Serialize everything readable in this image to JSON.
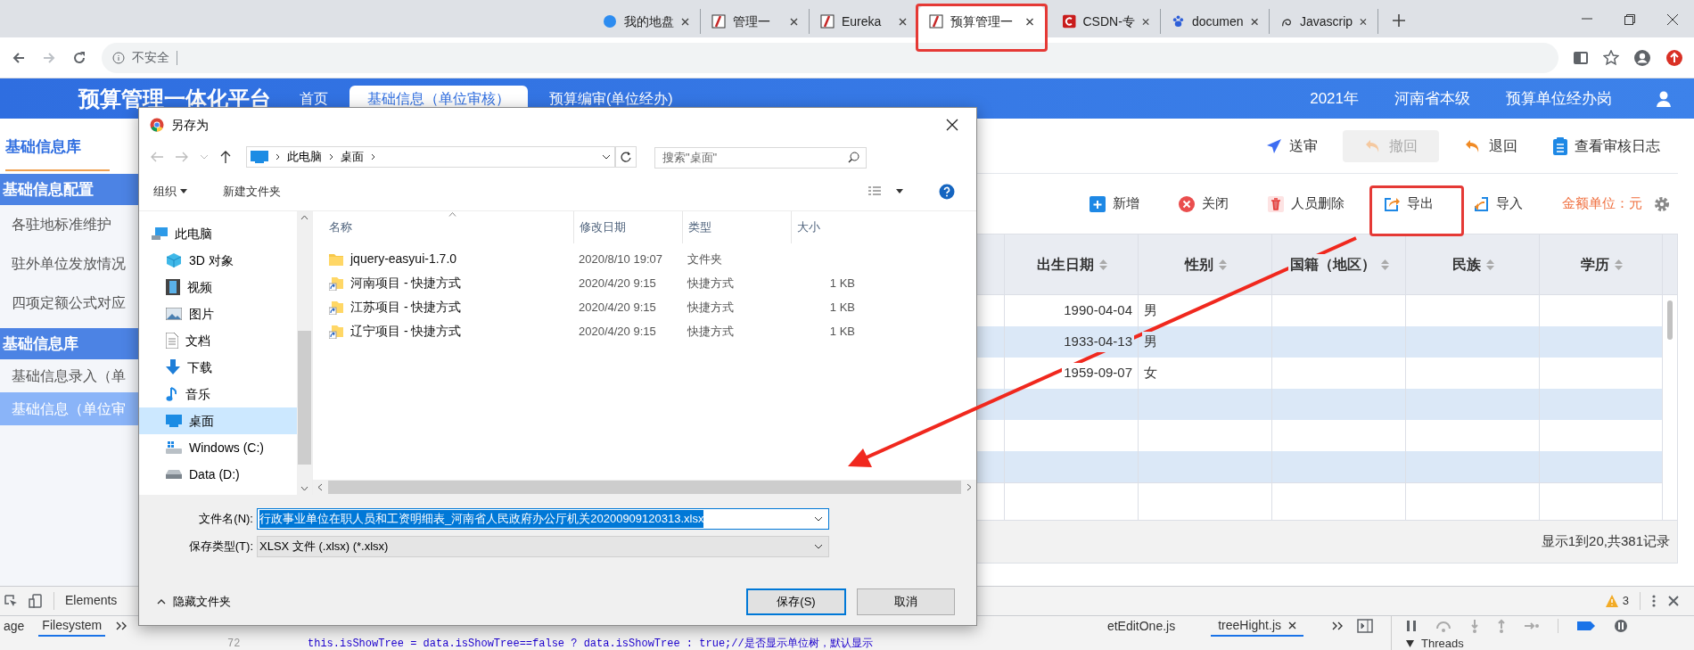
{
  "browser": {
    "tabs": [
      {
        "title": "我的地盘",
        "selected": false
      },
      {
        "title": "管理一",
        "selected": false
      },
      {
        "title": "Eureka",
        "selected": false
      },
      {
        "title": "预算管理一",
        "selected": true
      },
      {
        "title": "CSDN-专",
        "selected": false
      },
      {
        "title": "documen",
        "selected": false
      },
      {
        "title": "Javascrip",
        "selected": false
      }
    ],
    "security": "不安全"
  },
  "header": {
    "title": "预算管理一体化平台",
    "nav": [
      {
        "label": "首页",
        "selected": false
      },
      {
        "label": "基础信息（单位审核）",
        "selected": true
      },
      {
        "label": "预算编审(单位经办)",
        "selected": false
      }
    ],
    "year": "2021年",
    "region": "河南省本级",
    "role": "预算单位经办岗"
  },
  "sidebar": {
    "title": "基础信息库",
    "groups": [
      {
        "label": "基础信息配置",
        "items": [
          {
            "label": "各驻地标准维护",
            "selected": false
          },
          {
            "label": "驻外单位发放情况",
            "selected": false
          },
          {
            "label": "四项定额公式对应",
            "selected": false
          }
        ]
      },
      {
        "label": "基础信息库",
        "items": [
          {
            "label": "基础信息录入（单",
            "selected": false
          },
          {
            "label": "基础信息（单位审",
            "selected": true
          }
        ]
      }
    ]
  },
  "actions": [
    {
      "label": "送审",
      "kind": "send",
      "disabled": false
    },
    {
      "label": "撤回",
      "kind": "undo",
      "disabled": true
    },
    {
      "label": "退回",
      "kind": "undo",
      "disabled": false
    },
    {
      "label": "查看审核日志",
      "kind": "log",
      "disabled": false
    }
  ],
  "toolbar": {
    "buttons": [
      {
        "label": "新增",
        "kind": "add"
      },
      {
        "label": "关闭",
        "kind": "close"
      },
      {
        "label": "人员删除",
        "kind": "delete"
      },
      {
        "label": "导出",
        "kind": "export"
      },
      {
        "label": "导入",
        "kind": "import"
      }
    ],
    "unit": "金额单位：元"
  },
  "table": {
    "columns": [
      "出生日期",
      "性别",
      "国籍（地区）",
      "民族",
      "学历"
    ],
    "rows": [
      {
        "cells": [
          "1990-04-04",
          "男"
        ]
      },
      {
        "cells": [
          "1933-04-13",
          "男"
        ]
      },
      {
        "cells": [
          "1959-09-07",
          "女"
        ]
      }
    ],
    "footer": "显示1到20,共381记录"
  },
  "dialog": {
    "title": "另存为",
    "path": [
      "此电脑",
      "桌面"
    ],
    "search_placeholder": "搜索\"桌面\"",
    "organize": "组织",
    "new_folder": "新建文件夹",
    "nav": [
      {
        "label": "此电脑",
        "kind": "pc",
        "selected": false
      },
      {
        "label": "3D 对象",
        "kind": "cube",
        "selected": false
      },
      {
        "label": "视频",
        "kind": "video",
        "selected": false
      },
      {
        "label": "图片",
        "kind": "picture",
        "selected": false
      },
      {
        "label": "文档",
        "kind": "document",
        "selected": false
      },
      {
        "label": "下载",
        "kind": "download",
        "selected": false
      },
      {
        "label": "音乐",
        "kind": "music",
        "selected": false
      },
      {
        "label": "桌面",
        "kind": "desktop",
        "selected": true
      },
      {
        "label": "Windows (C:)",
        "kind": "windrive",
        "selected": false
      },
      {
        "label": "Data (D:)",
        "kind": "drive",
        "selected": false
      }
    ],
    "columns": [
      "名称",
      "修改日期",
      "类型",
      "大小"
    ],
    "files": [
      {
        "name": "jquery-easyui-1.7.0",
        "date": "2020/8/10 19:07",
        "type": "文件夹",
        "kind": "folder"
      },
      {
        "name": "河南项目 - 快捷方式",
        "date": "2020/4/20 9:15",
        "type": "快捷方式",
        "size": "1 KB",
        "kind": "shortcut"
      },
      {
        "name": "江苏项目 - 快捷方式",
        "date": "2020/4/20 9:15",
        "type": "快捷方式",
        "size": "1 KB",
        "kind": "shortcut"
      },
      {
        "name": "辽宁项目 - 快捷方式",
        "date": "2020/4/20 9:15",
        "type": "快捷方式",
        "size": "1 KB",
        "kind": "shortcut"
      }
    ],
    "filename_label": "文件名(N):",
    "filename": "行政事业单位在职人员和工资明细表_河南省人民政府办公厅机关20200909120313.xlsx",
    "filetype_label": "保存类型(T):",
    "filetype": "XLSX 文件 (.xlsx) (*.xlsx)",
    "hide_folders": "隐藏文件夹",
    "save": "保存(S)",
    "cancel": "取消"
  },
  "devtools": {
    "panel_tab": "Elements",
    "warnings": "3",
    "nav_tabs": [
      {
        "label": "age",
        "selected": false
      },
      {
        "label": "Filesystem",
        "selected": true
      }
    ],
    "files": [
      {
        "label": "etEditOne.js",
        "selected": false
      },
      {
        "label": "treeHight.js",
        "selected": true
      }
    ],
    "line_number": "72",
    "code": "this.isShowTree = data.isShowTree==false ? data.isShowTree : true;//是否显示单位树，默认显示",
    "threads": "Threads"
  }
}
